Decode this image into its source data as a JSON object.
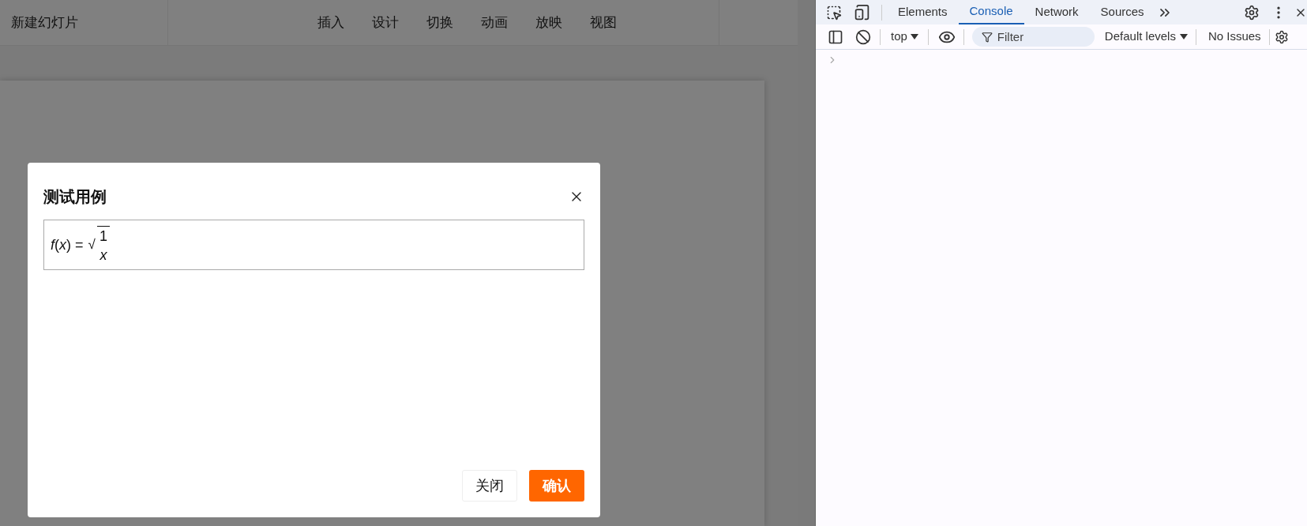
{
  "app": {
    "title": "新建幻灯片",
    "menu": [
      {
        "label": "插入"
      },
      {
        "label": "设计"
      },
      {
        "label": "切换"
      },
      {
        "label": "动画"
      },
      {
        "label": "放映"
      },
      {
        "label": "视图"
      }
    ]
  },
  "dialog": {
    "title": "测试用例",
    "formula": {
      "lhs": "*f*(*x*) =",
      "radical": "√",
      "numerator": "1",
      "denominator": "*x*"
    },
    "buttons": [
      {
        "label": "关闭",
        "kind": "secondary"
      },
      {
        "label": "确认",
        "kind": "primary"
      }
    ]
  },
  "devtools": {
    "tabs": [
      {
        "label": "Elements",
        "selected": false
      },
      {
        "label": "Console",
        "selected": true
      },
      {
        "label": "Network",
        "selected": false
      },
      {
        "label": "Sources",
        "selected": false
      }
    ],
    "context": "top",
    "filter_placeholder": "Filter",
    "levels": "Default levels",
    "issues": "No Issues"
  }
}
